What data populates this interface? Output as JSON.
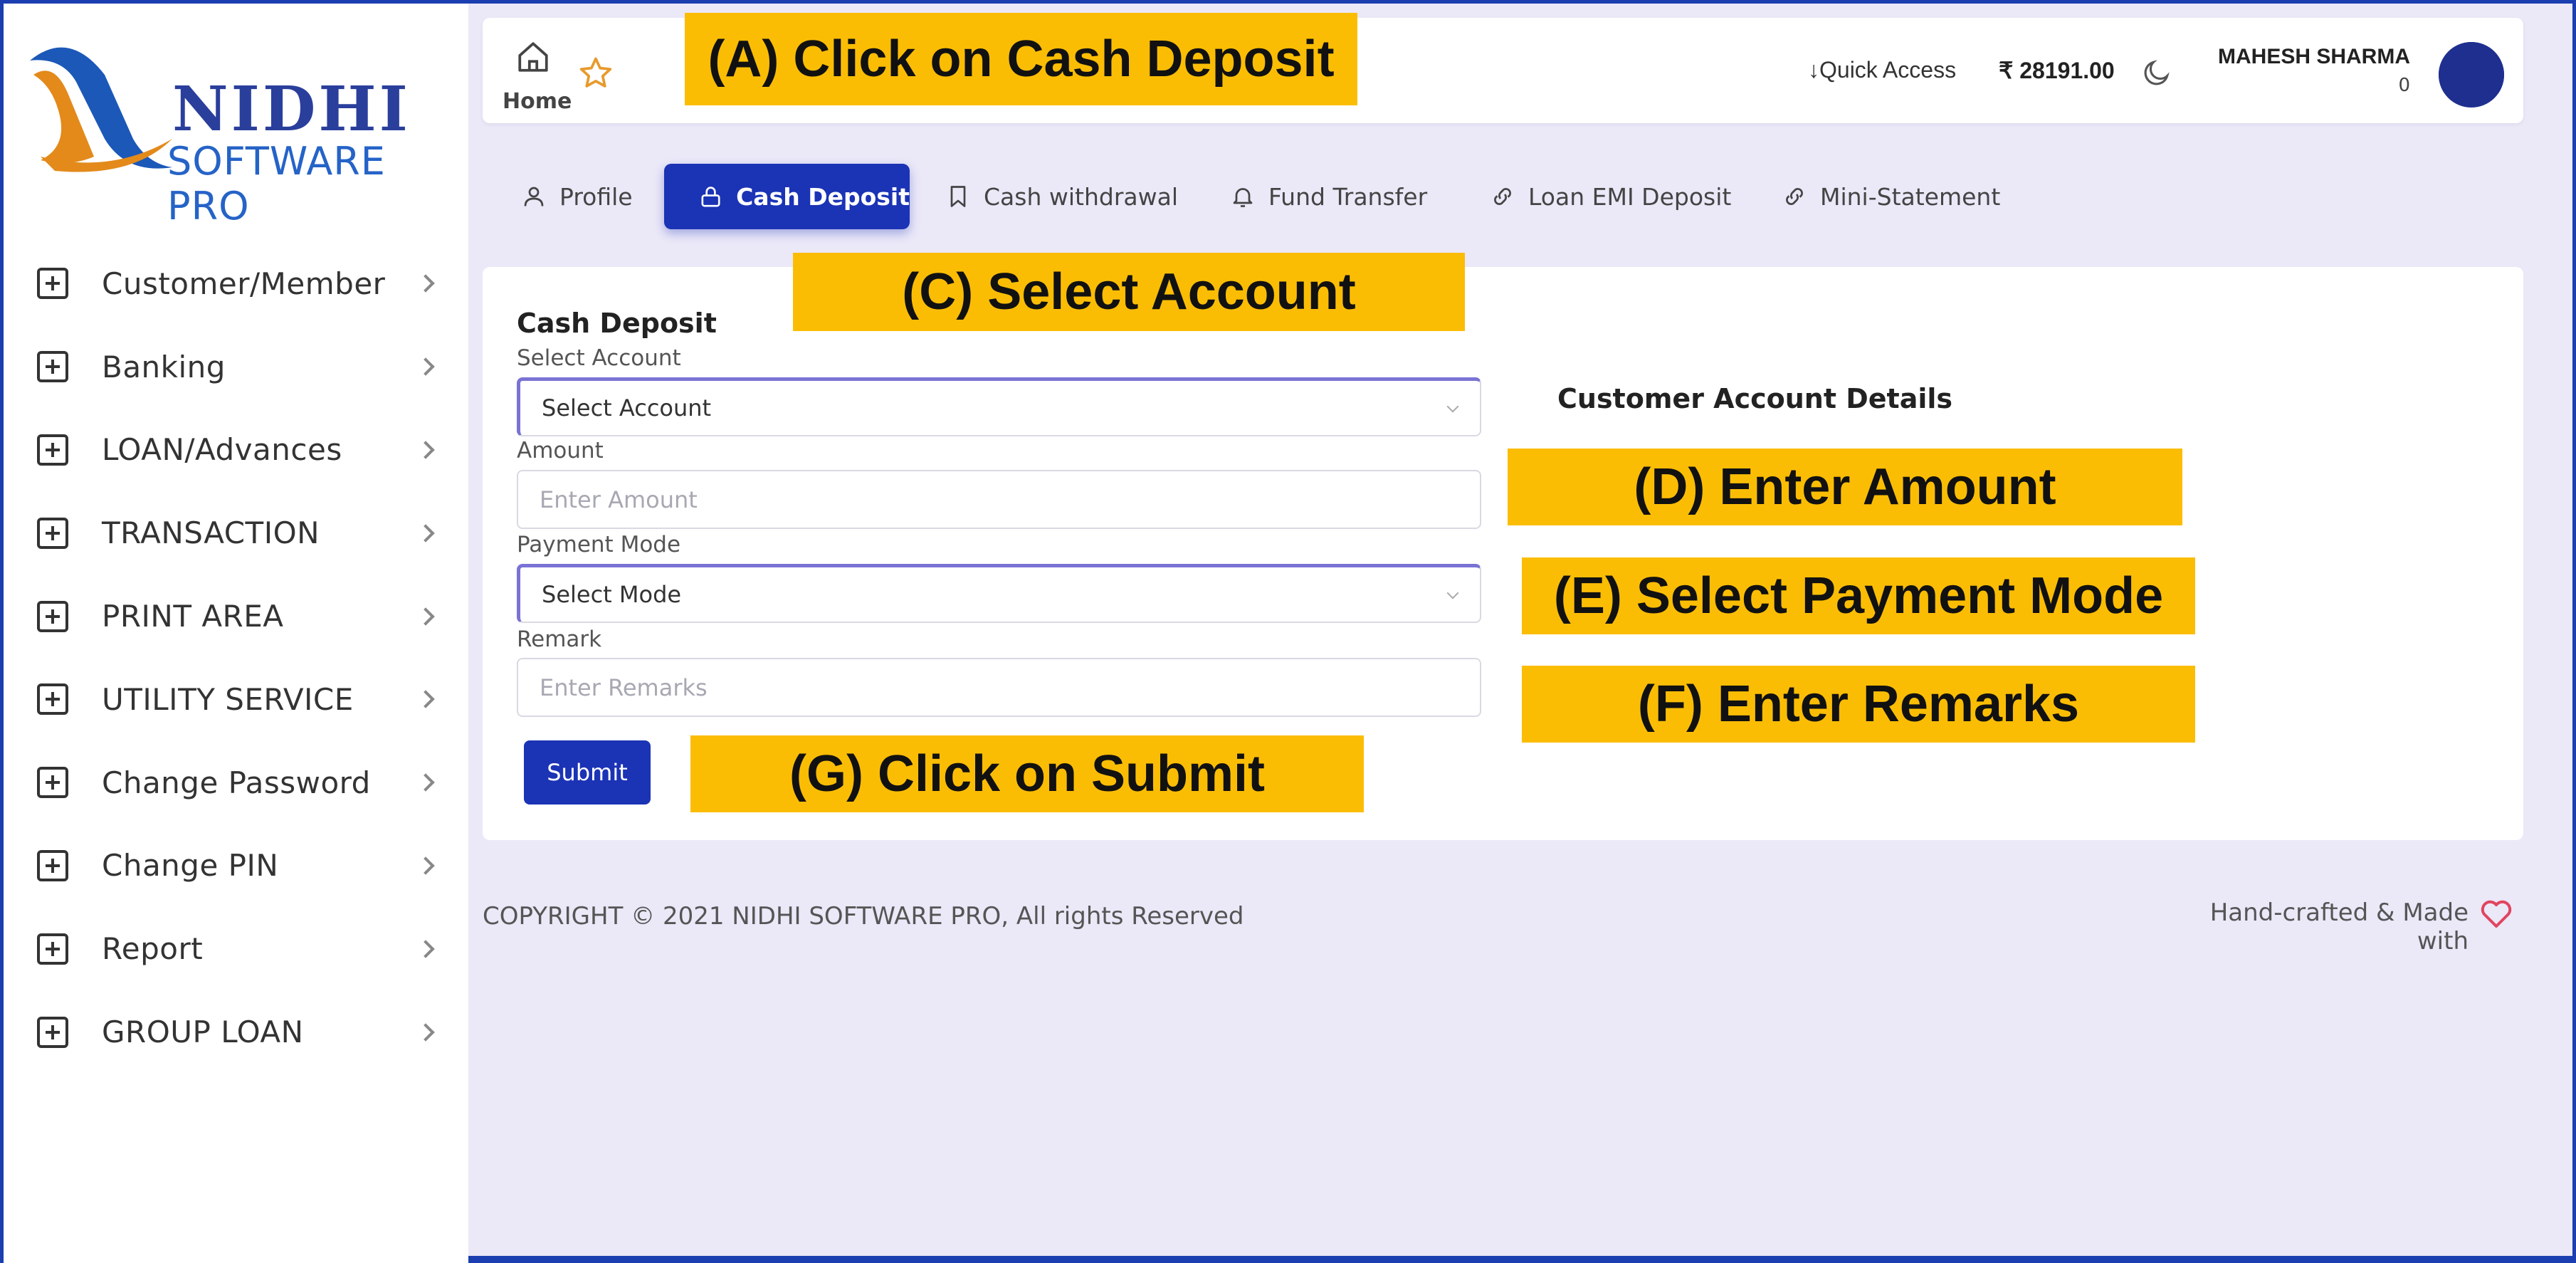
{
  "brand": {
    "line1": "NIDHI",
    "line2": "SOFTWARE PRO"
  },
  "sidebar": {
    "items": [
      {
        "label": "Customer/Member"
      },
      {
        "label": "Banking"
      },
      {
        "label": "LOAN/Advances"
      },
      {
        "label": "TRANSACTION"
      },
      {
        "label": "PRINT AREA"
      },
      {
        "label": "UTILITY SERVICE"
      },
      {
        "label": "Change Password"
      },
      {
        "label": "Change PIN"
      },
      {
        "label": "Report"
      },
      {
        "label": "GROUP LOAN"
      }
    ]
  },
  "topbar": {
    "home_label": "Home",
    "quick_access": "Quick Access",
    "balance": "₹ 28191.00",
    "user_name": "MAHESH SHARMA",
    "user_count": "0"
  },
  "tabs": [
    {
      "label": "Profile",
      "icon": "user-icon"
    },
    {
      "label": "Cash Deposit",
      "icon": "lock-icon",
      "active": true
    },
    {
      "label": "Cash withdrawal",
      "icon": "bookmark-icon"
    },
    {
      "label": "Fund Transfer",
      "icon": "bell-icon"
    },
    {
      "label": "Loan EMI Deposit",
      "icon": "link-icon"
    },
    {
      "label": "Mini-Statement",
      "icon": "link-icon"
    }
  ],
  "form": {
    "title": "Cash Deposit",
    "account_label": "Select Account",
    "account_value": "Select Account",
    "amount_label": "Amount",
    "amount_placeholder": "Enter Amount",
    "payment_label": "Payment Mode",
    "payment_value": "Select Mode",
    "remark_label": "Remark",
    "remark_placeholder": "Enter Remarks",
    "submit_label": "Submit"
  },
  "details": {
    "title": "Customer Account Details"
  },
  "footer": {
    "copyright": "COPYRIGHT © 2021 NIDHI SOFTWARE PRO, All rights Reserved",
    "made_with": "Hand-crafted & Made with"
  },
  "callouts": {
    "a": "(A) Click on Cash Deposit",
    "c": "(C) Select Account",
    "d": "(D) Enter  Amount",
    "e": "(E) Select Payment Mode",
    "f": "(F) Enter Remarks",
    "g": "(G) Click on Submit"
  },
  "colors": {
    "primary": "#1b33b5",
    "frame": "#1b3fb0",
    "background": "#ebe8f8",
    "callout": "#fbbd04",
    "logo_orange": "#e38a1b"
  }
}
